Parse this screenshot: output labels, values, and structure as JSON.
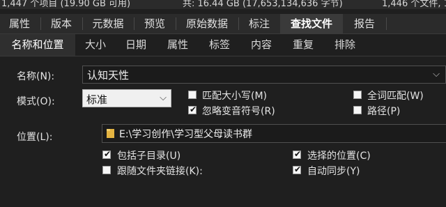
{
  "status_bar": {
    "left": "1,447 个项目 (19.90 GB 可用)",
    "middle": "共: 16.44 GB (17,653,134,636 字节)",
    "right": "1,446 个文件, 1 ..."
  },
  "main_tabs": [
    {
      "label": "属性"
    },
    {
      "label": "版本"
    },
    {
      "label": "元数据"
    },
    {
      "label": "预览"
    },
    {
      "label": "原始数据"
    },
    {
      "label": "标注"
    },
    {
      "label": "查找文件",
      "active": true
    },
    {
      "label": "报告"
    }
  ],
  "sub_tabs": [
    {
      "label": "名称和位置",
      "active": true
    },
    {
      "label": "大小"
    },
    {
      "label": "日期"
    },
    {
      "label": "属性"
    },
    {
      "label": "标签"
    },
    {
      "label": "内容"
    },
    {
      "label": "重复"
    },
    {
      "label": "排除"
    }
  ],
  "form": {
    "name_label": "名称(N):",
    "name_value": "认知天性",
    "mode_label": "模式(O):",
    "mode_value": "标准",
    "location_label": "位置(L):",
    "location_value": "E:\\学习创作\\学习型父母读书群",
    "options": {
      "match_case": {
        "label": "匹配大小写(M)",
        "checked": false
      },
      "ignore_diacritics": {
        "label": "忽略变音符号(R)",
        "checked": true
      },
      "whole_word": {
        "label": "全词匹配(W)",
        "checked": false
      },
      "path": {
        "label": "路径(P)",
        "checked": false
      },
      "include_subfolders": {
        "label": "包括子目录(U)",
        "checked": true
      },
      "follow_links": {
        "label": "跟随文件夹链接(K):",
        "checked": false
      },
      "selected_location": {
        "label": "选择的位置(C)",
        "checked": true
      },
      "auto_sync": {
        "label": "自动同步(Y)",
        "checked": true
      }
    }
  },
  "icons": {
    "dropdown": "chevron-down-icon",
    "folder": "folder-icon",
    "check": "checkmark-icon"
  }
}
